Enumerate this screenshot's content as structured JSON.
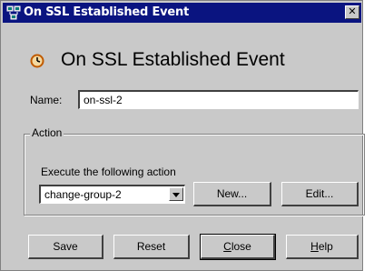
{
  "window": {
    "title": "On SSL Established Event",
    "close_glyph": "✕",
    "title_icon": "network-computers-icon"
  },
  "heading": {
    "text": "On SSL Established Event",
    "icon": "clock-icon"
  },
  "name_field": {
    "label": "Name:",
    "value": "on-ssl-2"
  },
  "action_group": {
    "legend": "Action",
    "instruction": "Execute the following action",
    "selected_action": "change-group-2",
    "new_label": "New...",
    "edit_label": "Edit..."
  },
  "footer": {
    "save_label": "Save",
    "reset_label": "Reset",
    "close_label": "Close",
    "help_label": "Help"
  },
  "colors": {
    "titlebar": "#0a1480",
    "dialog_bg": "#c9c9c9",
    "icon_accent": "#c05a00"
  }
}
